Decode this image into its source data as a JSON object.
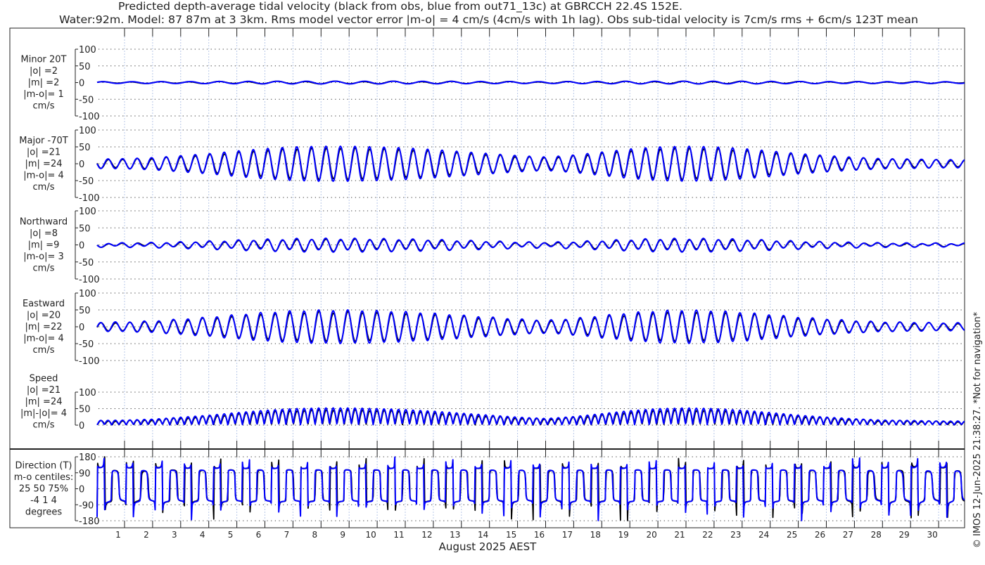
{
  "chart_data": {
    "type": "line",
    "title_lines": [
      "Predicted depth-average tidal velocity (black from obs, blue from out71_13c) at GBRCCH 22.4S 152E.",
      "Water:92m. Model: 87 87m at 3 3km. Rms model vector error |m-o| = 4 cm/s (4cm/s with 1h lag). Obs sub-tidal velocity is 7cm/s rms + 6cm/s 123T mean"
    ],
    "xlabel": "August 2025 AEST",
    "x_ticks": [
      "1",
      "2",
      "3",
      "4",
      "5",
      "6",
      "7",
      "8",
      "9",
      "10",
      "11",
      "12",
      "13",
      "14",
      "15",
      "16",
      "17",
      "18",
      "19",
      "20",
      "21",
      "22",
      "23",
      "24",
      "25",
      "26",
      "27",
      "28",
      "29",
      "30"
    ],
    "footer": "© IMOS 12-Jun-2025 21:38:27. *Not for navigation*",
    "colors": {
      "obs": "#000000",
      "model": "#0000ff",
      "grid_day": "#b8c8e8"
    },
    "major_axis_deg_true": -70,
    "daily_major_amplitude_cm_s": [
      14,
      15,
      18,
      24,
      30,
      38,
      45,
      50,
      52,
      52,
      50,
      47,
      42,
      36,
      30,
      24,
      20,
      26,
      35,
      44,
      50,
      52,
      50,
      45,
      38,
      30,
      24,
      19,
      15,
      14,
      12
    ],
    "panels": [
      {
        "key": "minor",
        "labels": [
          "Minor 20T",
          "|o| =2",
          "|m| =2",
          "|m-o|= 1",
          "cm/s"
        ],
        "ylim": [
          -100,
          100
        ],
        "yticks": [
          "100",
          "50",
          "0",
          "-50",
          "-100"
        ]
      },
      {
        "key": "major",
        "labels": [
          "Major -70T",
          "|o| =21",
          "|m| =24",
          "|m-o|= 4",
          "cm/s"
        ],
        "ylim": [
          -100,
          100
        ],
        "yticks": [
          "100",
          "50",
          "0",
          "-50",
          "-100"
        ]
      },
      {
        "key": "north",
        "labels": [
          "Northward",
          "|o| =8",
          "|m| =9",
          "|m-o|= 3",
          "cm/s"
        ],
        "ylim": [
          -100,
          100
        ],
        "yticks": [
          "100",
          "50",
          "0",
          "-50",
          "-100"
        ]
      },
      {
        "key": "east",
        "labels": [
          "Eastward",
          "|o| =20",
          "|m| =22",
          "|m-o|= 4",
          "cm/s"
        ],
        "ylim": [
          -100,
          100
        ],
        "yticks": [
          "100",
          "50",
          "0",
          "-50",
          "-100"
        ]
      },
      {
        "key": "speed",
        "labels": [
          "Speed",
          "|o| =21",
          "|m| =24",
          "|m|-|o|= 4",
          "cm/s"
        ],
        "ylim": [
          0,
          100
        ],
        "yticks": [
          "100",
          "50",
          "0"
        ]
      },
      {
        "key": "direction",
        "labels": [
          "Direction (T)",
          "m-o centiles:",
          "25  50  75%",
          "-4  1  4",
          "degrees"
        ],
        "ylim": [
          -180,
          180
        ],
        "yticks": [
          "180",
          "90",
          "0",
          "-90",
          "-180"
        ]
      }
    ]
  }
}
